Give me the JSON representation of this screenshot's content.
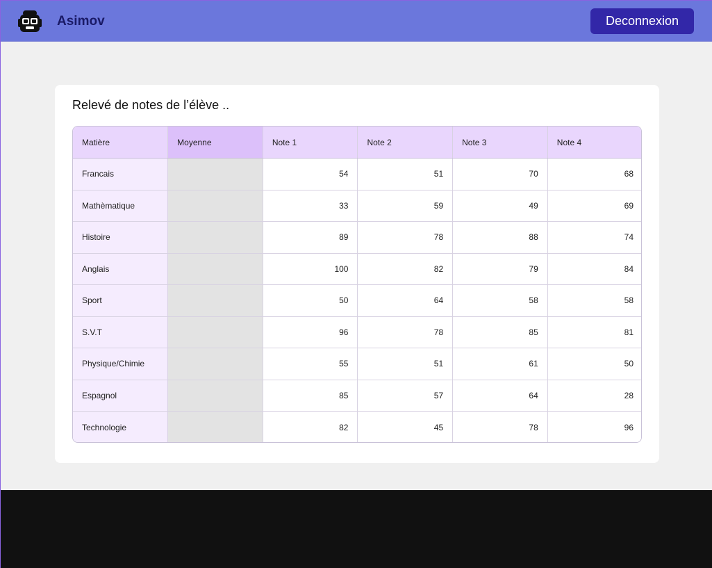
{
  "header": {
    "brand": "Asimov",
    "logo_icon": "robot-face-icon",
    "logout_label": "Deconnexion",
    "bg_color": "#6b77dc",
    "logout_color": "#3227a8"
  },
  "main": {
    "title": "Relevé de notes de l’élève ..",
    "table": {
      "headers": [
        "Matière",
        "Moyenne",
        "Note 1",
        "Note 2",
        "Note 3",
        "Note 4"
      ],
      "rows": [
        {
          "subject": "Francais",
          "moyenne": "",
          "notes": [
            "54",
            "51",
            "70",
            "68"
          ]
        },
        {
          "subject": "Mathèmatique",
          "moyenne": "",
          "notes": [
            "33",
            "59",
            "49",
            "69"
          ]
        },
        {
          "subject": "Histoire",
          "moyenne": "",
          "notes": [
            "89",
            "78",
            "88",
            "74"
          ]
        },
        {
          "subject": "Anglais",
          "moyenne": "",
          "notes": [
            "100",
            "82",
            "79",
            "84"
          ]
        },
        {
          "subject": "Sport",
          "moyenne": "",
          "notes": [
            "50",
            "64",
            "58",
            "58"
          ]
        },
        {
          "subject": "S.V.T",
          "moyenne": "",
          "notes": [
            "96",
            "78",
            "85",
            "81"
          ]
        },
        {
          "subject": "Physique/Chimie",
          "moyenne": "",
          "notes": [
            "55",
            "51",
            "61",
            "50"
          ]
        },
        {
          "subject": "Espagnol",
          "moyenne": "",
          "notes": [
            "85",
            "57",
            "64",
            "28"
          ]
        },
        {
          "subject": "Technologie",
          "moyenne": "",
          "notes": [
            "82",
            "45",
            "78",
            "96"
          ]
        }
      ]
    }
  }
}
